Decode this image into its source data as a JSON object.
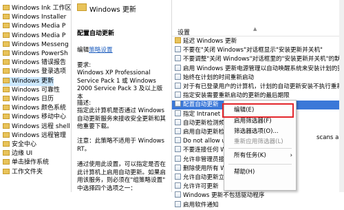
{
  "tree_items": [
    "Windows Ink 工作区",
    "Windows Installer",
    "Windows Media P",
    "Windows Media P",
    "Windows Messeng",
    "Windows PowerSh",
    "Windows 错误报告",
    "Windows 登录选项",
    "Windows 更新",
    "Windows 可靠性",
    "Windows 日历",
    "Windows 颜色系统",
    "Windows 移动中心",
    "Windows 远程 shell",
    "Windows 远程管理",
    "安全中心",
    "边缘 UI",
    "单击操作系统",
    "工作文件夹"
  ],
  "selected_tree_index": 8,
  "folder_title": "Windows 更新",
  "detail": {
    "heading": "配置自动更新",
    "edit_prefix": "编辑",
    "edit_link": "策略设置",
    "req_title": "要求:",
    "req_lines": [
      "Windows XP Professional",
      "Service Pack 1 或 Windows",
      "2000 Service Pack 3 及以上版本"
    ],
    "desc_title": "描述:",
    "desc_lines": [
      "指定此计算机是否通过 Windows",
      "自动更新服务来接收安全更新和其",
      "他重要下载。"
    ],
    "note_lines": [
      "注意：此策略不适用于 Windows",
      "RT。"
    ],
    "more_lines": [
      "通过使用此设置，可以指定是否在",
      "此计算机上启用自动更新。如果启",
      "用该服务，则必须在\"组策略设置\"",
      "中选择四个选项之一："
    ]
  },
  "settings": {
    "column": "设置",
    "rows": [
      {
        "text": "延迟 Windows 更新",
        "folder": true
      },
      {
        "text": "不要在\"关闭 Windows\"对话框显示\"安装更新并关机\""
      },
      {
        "text": "不要调整\"关闭 Windows\"对话框里的\"安装更新并关机\"的默"
      },
      {
        "text": "启用 Windows 更新电源管理以自动唤醒系统来安装计划的更新"
      },
      {
        "text": "始终在计划的时间重新启动"
      },
      {
        "text": "对于有已登录用户的计算机，计划的自动更新安装不执行重新启动"
      },
      {
        "text": "指定安装需要重新启动的更新的最后期限"
      },
      {
        "text": "配置自动更新"
      },
      {
        "text": "指定 Intranet M"
      },
      {
        "text": "自动更新检测频率"
      },
      {
        "text": "启用自动更新检查"
      },
      {
        "text": "Do not allow up"
      },
      {
        "text": "不要连接任何 W"
      },
      {
        "text": "允许非管理员接"
      },
      {
        "text": "删除使用所有 W"
      },
      {
        "text": "允许自动更新立"
      },
      {
        "text": "允许许可更新"
      },
      {
        "text": "Windows 更新不包括驱动程序"
      },
      {
        "text": "启用软件通知"
      }
    ],
    "trailing_text": "scans a"
  },
  "selected_setting_index": 7,
  "context_menu": [
    {
      "label": "编辑(E)",
      "enabled": true
    },
    {
      "label": "启用筛选器(F)",
      "enabled": true
    },
    {
      "label": "筛选器选项(O)...",
      "enabled": true
    },
    {
      "label": "重新应用筛选器(L)",
      "enabled": false
    },
    {
      "label": "所有任务(K)",
      "enabled": true,
      "submenu": true
    },
    {
      "label": "帮助(H)",
      "enabled": true
    }
  ],
  "colors": {
    "selection": "#3b78d8",
    "highlight_box": "#e3262b"
  }
}
